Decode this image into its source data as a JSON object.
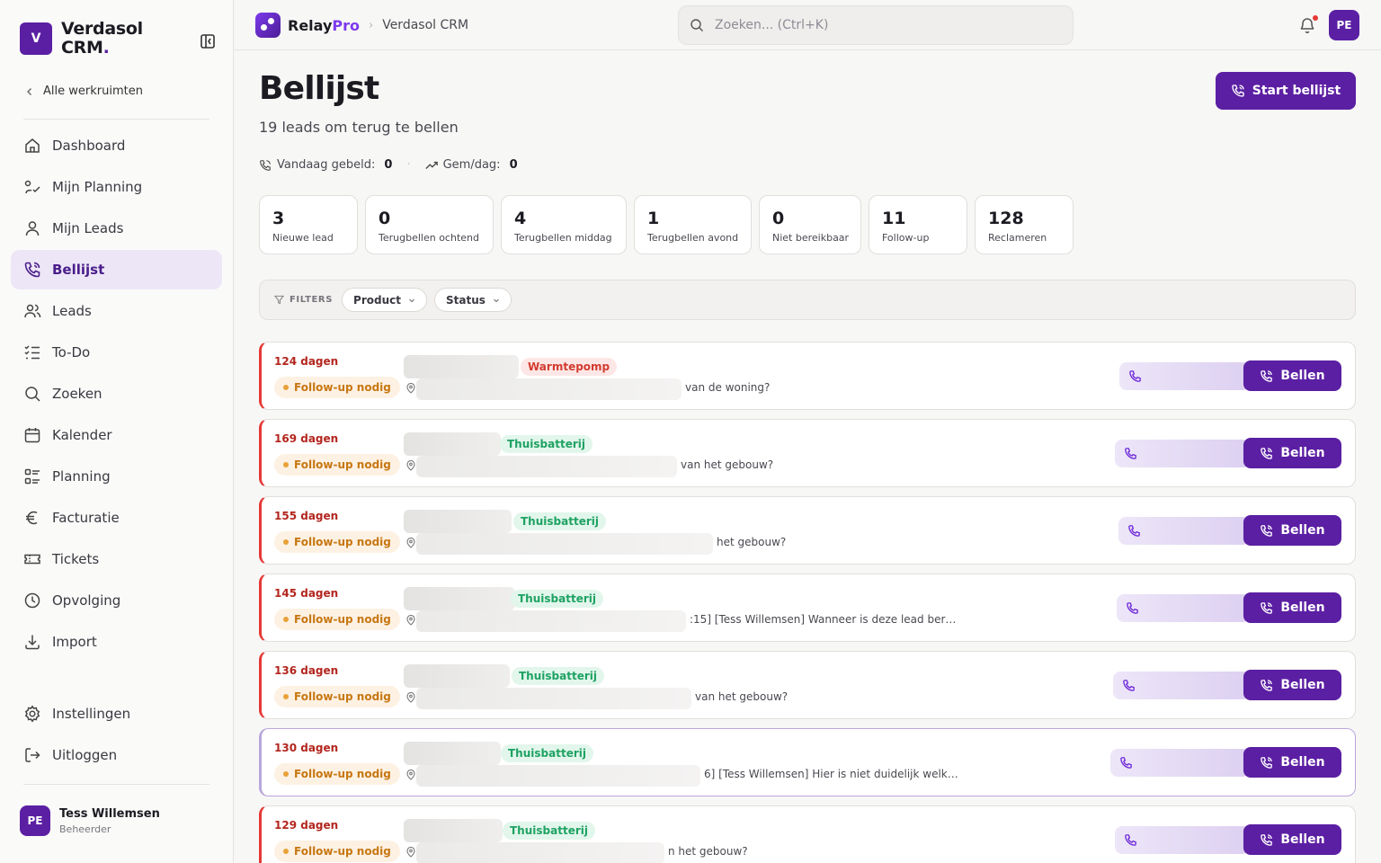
{
  "brand": {
    "badge": "V",
    "name_line1": "Verdasol",
    "name_line2": "CRM",
    "name_dot": "."
  },
  "back_link": "Alle werkruimten",
  "nav": [
    {
      "label": "Dashboard",
      "icon": "home-icon"
    },
    {
      "label": "Mijn Planning",
      "icon": "route-icon"
    },
    {
      "label": "Mijn Leads",
      "icon": "user-icon"
    },
    {
      "label": "Bellijst",
      "icon": "phone-call-icon",
      "active": true
    },
    {
      "label": "Leads",
      "icon": "users-icon"
    },
    {
      "label": "To-Do",
      "icon": "checklist-icon"
    },
    {
      "label": "Zoeken",
      "icon": "search-icon"
    },
    {
      "label": "Kalender",
      "icon": "calendar-icon"
    },
    {
      "label": "Planning",
      "icon": "planning-icon"
    },
    {
      "label": "Facturatie",
      "icon": "euro-icon"
    },
    {
      "label": "Tickets",
      "icon": "ticket-icon"
    },
    {
      "label": "Opvolging",
      "icon": "clock-icon"
    },
    {
      "label": "Import",
      "icon": "download-icon"
    }
  ],
  "nav_bottom": [
    {
      "label": "Instellingen",
      "icon": "gear-icon"
    },
    {
      "label": "Uitloggen",
      "icon": "logout-icon"
    }
  ],
  "user": {
    "initials": "PE",
    "name": "Tess Willemsen",
    "role": "Beheerder"
  },
  "topbar": {
    "logo_main": "Relay",
    "logo_accent": "Pro",
    "breadcrumb_sep": "›",
    "breadcrumb": "Verdasol CRM",
    "search_placeholder": "Zoeken... (Ctrl+K)",
    "avatar": "PE"
  },
  "page": {
    "title": "Bellijst",
    "subtitle": "19 leads om terug te bellen",
    "start_button": "Start bellijst",
    "called_today_label": "Vandaag gebeld:",
    "called_today_value": "0",
    "avg_label": "Gem/dag:",
    "avg_value": "0",
    "stats_sep": "·"
  },
  "stat_cards": [
    {
      "value": "3",
      "label": "Nieuwe lead"
    },
    {
      "value": "0",
      "label": "Terugbellen ochtend"
    },
    {
      "value": "4",
      "label": "Terugbellen middag"
    },
    {
      "value": "1",
      "label": "Terugbellen avond"
    },
    {
      "value": "0",
      "label": "Niet bereikbaar"
    },
    {
      "value": "11",
      "label": "Follow-up"
    },
    {
      "value": "128",
      "label": "Reclameren"
    }
  ],
  "filters": {
    "label": "FILTERS",
    "product": "Product",
    "status": "Status"
  },
  "leads": [
    {
      "days": "124 dagen",
      "status": "Follow-up nodig",
      "product": "Warmtepomp",
      "product_kind": "warm",
      "note": "van de woning?",
      "call": "Bellen"
    },
    {
      "days": "169 dagen",
      "status": "Follow-up nodig",
      "product": "Thuisbatterij",
      "product_kind": "bat",
      "note": "van het gebouw?",
      "call": "Bellen"
    },
    {
      "days": "155 dagen",
      "status": "Follow-up nodig",
      "product": "Thuisbatterij",
      "product_kind": "bat",
      "note": "het gebouw?",
      "call": "Bellen"
    },
    {
      "days": "145 dagen",
      "status": "Follow-up nodig",
      "product": "Thuisbatterij",
      "product_kind": "bat",
      "note": ":15] [Tess Willemsen] Wanneer is deze lead ber…",
      "call": "Bellen"
    },
    {
      "days": "136 dagen",
      "status": "Follow-up nodig",
      "product": "Thuisbatterij",
      "product_kind": "bat",
      "note": "van het gebouw?",
      "call": "Bellen"
    },
    {
      "days": "130 dagen",
      "status": "Follow-up nodig",
      "product": "Thuisbatterij",
      "product_kind": "bat",
      "note": "6] [Tess Willemsen] Hier is niet duidelijk welk…",
      "call": "Bellen",
      "selected": true
    },
    {
      "days": "129 dagen",
      "status": "Follow-up nodig",
      "product": "Thuisbatterij",
      "product_kind": "bat",
      "note": "n het gebouw?",
      "call": "Bellen"
    }
  ]
}
